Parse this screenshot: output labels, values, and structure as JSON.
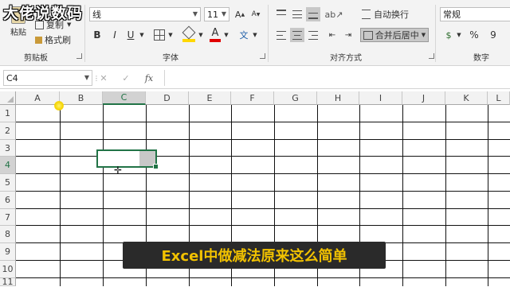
{
  "watermark": "大佬说数码",
  "ribbon": {
    "clipboard": {
      "paste": "粘贴",
      "copy": "复制",
      "format_painter": "格式刷",
      "label": "剪贴板"
    },
    "font": {
      "name_suffix": "线",
      "size": "11",
      "bold": "B",
      "italic": "I",
      "underline": "U",
      "font_color_glyph": "A",
      "wen": "文",
      "label": "字体"
    },
    "alignment": {
      "wrap_text": "自动换行",
      "merge_center": "合并后居中",
      "label": "对齐方式"
    },
    "number": {
      "format": "常规",
      "percent": "%",
      "comma": "9",
      "label": "数字"
    },
    "colors": {
      "fill_highlight": "#ffd800",
      "font_color_bar": "#e00000"
    }
  },
  "formula_bar": {
    "name_box": "C4",
    "cancel": "✕",
    "enter": "✓",
    "fx": "fx",
    "value": ""
  },
  "sheet": {
    "columns": [
      "A",
      "B",
      "C",
      "D",
      "E",
      "F",
      "G",
      "H",
      "I",
      "J",
      "K",
      "L"
    ],
    "rows": [
      "1",
      "2",
      "3",
      "4",
      "5",
      "6",
      "7",
      "8",
      "9",
      "10",
      "11"
    ],
    "active_cell": "C4"
  },
  "subtitle": "Excel中做减法原来这么简单"
}
